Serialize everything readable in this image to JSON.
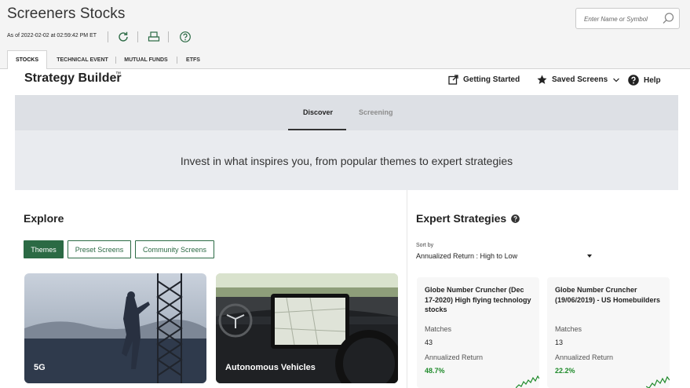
{
  "app": {
    "title": "Screeners Stocks",
    "as_of": "As of 2022-02-02 at 02:59:42 PM ET"
  },
  "search": {
    "placeholder": "Enter Name or Symbol"
  },
  "toolbar": {
    "icons": [
      "refresh-icon",
      "print-icon",
      "help-circle-icon"
    ]
  },
  "tabs": [
    {
      "label": "STOCKS",
      "active": true
    },
    {
      "label": "TECHNICAL EVENT",
      "active": false
    },
    {
      "label": "MUTUAL FUNDS",
      "active": false
    },
    {
      "label": "ETFS",
      "active": false
    }
  ],
  "strategy_builder": {
    "title": "Strategy Builder",
    "trademark": "™",
    "links": {
      "getting_started": "Getting Started",
      "saved_screens": "Saved Screens",
      "help": "Help"
    }
  },
  "hero": {
    "tabs": [
      {
        "label": "Discover",
        "active": true
      },
      {
        "label": "Screening",
        "active": false
      }
    ],
    "tagline": "Invest in what inspires you, from popular themes to expert strategies"
  },
  "explore": {
    "title": "Explore",
    "filters": [
      {
        "label": "Themes",
        "active": true
      },
      {
        "label": "Preset Screens",
        "active": false
      },
      {
        "label": "Community Screens",
        "active": false
      }
    ],
    "cards": [
      {
        "label": "5G"
      },
      {
        "label": "Autonomous Vehicles"
      }
    ]
  },
  "expert": {
    "title": "Expert Strategies",
    "sort_label": "Sort by",
    "sort_value": "Annualized Return : High to Low",
    "matches_label": "Matches",
    "return_label": "Annualized Return",
    "strategies": [
      {
        "name": "Globe Number Cruncher (Dec 17-2020) High flying technology stocks",
        "matches": "43",
        "return": "48.7%"
      },
      {
        "name": "Globe Number Cruncher (19/06/2019) - US Homebuilders",
        "matches": "13",
        "return": "22.2%"
      }
    ]
  },
  "colors": {
    "brand_green": "#2b6a44",
    "positive": "#1e8a2a"
  }
}
